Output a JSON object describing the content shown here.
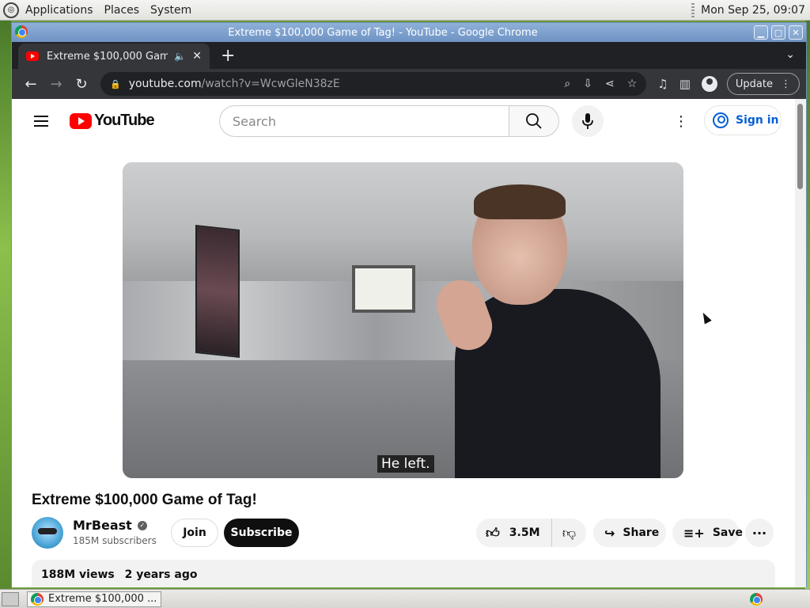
{
  "top_panel": {
    "menus": [
      "Applications",
      "Places",
      "System"
    ],
    "clock": "Mon Sep 25, 09:07"
  },
  "window": {
    "title": "Extreme $100,000 Game of Tag! - YouTube - Google Chrome"
  },
  "browser": {
    "tab_title": "Extreme $100,000 Game of Tag! - YouTube",
    "url_host": "youtube.com",
    "url_path": "/watch?v=WcwGleN38zE",
    "update_label": "Update"
  },
  "youtube": {
    "logo_text": "YouTube",
    "search_placeholder": "Search",
    "signin_label": "Sign in"
  },
  "video": {
    "caption": "He left.",
    "title": "Extreme $100,000 Game of Tag!",
    "channel": "MrBeast",
    "subscribers": "185M subscribers",
    "join_label": "Join",
    "subscribe_label": "Subscribe",
    "likes": "3.5M",
    "share_label": "Share",
    "save_label": "Save",
    "views": "188M views",
    "age": "2 years ago"
  },
  "taskbar": {
    "task_label": "Extreme $100,000 ..."
  },
  "icons": {
    "back": "arrow-left-icon",
    "forward": "arrow-right-icon",
    "reload": "reload-icon",
    "mic": "microphone-icon",
    "like": "thumbs-up-icon",
    "dislike": "thumbs-down-icon"
  },
  "colors": {
    "youtube_red": "#ff0000",
    "link_blue": "#065fd4",
    "chrome_dark": "#35363a"
  }
}
